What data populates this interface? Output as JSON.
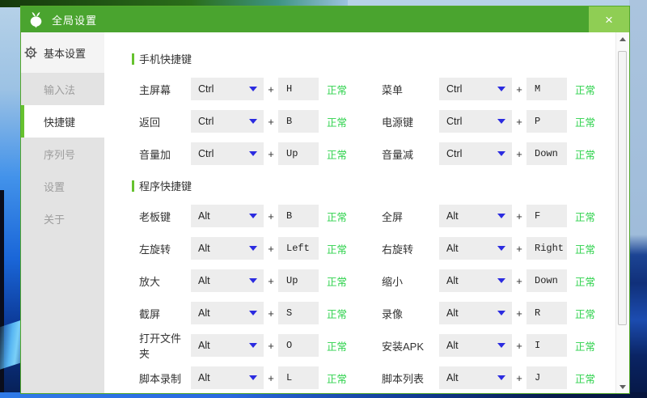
{
  "window": {
    "title": "全局设置",
    "close_glyph": "×"
  },
  "sidebar": {
    "primary": {
      "label": "基本设置",
      "icon": "gear-icon"
    },
    "items": [
      {
        "label": "输入法",
        "selected": false
      },
      {
        "label": "快捷键",
        "selected": true
      },
      {
        "label": "序列号",
        "selected": false
      },
      {
        "label": "设置",
        "selected": false
      },
      {
        "label": "关于",
        "selected": false
      }
    ]
  },
  "content": {
    "plus_sign": "+",
    "sections": [
      {
        "title": "手机快捷键",
        "pairs": [
          [
            {
              "label": "主屏幕",
              "modifier": "Ctrl",
              "key": "H",
              "status": "正常"
            },
            {
              "label": "菜单",
              "modifier": "Ctrl",
              "key": "M",
              "status": "正常"
            }
          ],
          [
            {
              "label": "返回",
              "modifier": "Ctrl",
              "key": "B",
              "status": "正常"
            },
            {
              "label": "电源键",
              "modifier": "Ctrl",
              "key": "P",
              "status": "正常"
            }
          ],
          [
            {
              "label": "音量加",
              "modifier": "Ctrl",
              "key": "Up",
              "status": "正常"
            },
            {
              "label": "音量减",
              "modifier": "Ctrl",
              "key": "Down",
              "status": "正常"
            }
          ]
        ]
      },
      {
        "title": "程序快捷键",
        "pairs": [
          [
            {
              "label": "老板键",
              "modifier": "Alt",
              "key": "B",
              "status": "正常"
            },
            {
              "label": "全屏",
              "modifier": "Alt",
              "key": "F",
              "status": "正常"
            }
          ],
          [
            {
              "label": "左旋转",
              "modifier": "Alt",
              "key": "Left",
              "status": "正常"
            },
            {
              "label": "右旋转",
              "modifier": "Alt",
              "key": "Right",
              "status": "正常"
            }
          ],
          [
            {
              "label": "放大",
              "modifier": "Alt",
              "key": "Up",
              "status": "正常"
            },
            {
              "label": "缩小",
              "modifier": "Alt",
              "key": "Down",
              "status": "正常"
            }
          ],
          [
            {
              "label": "截屏",
              "modifier": "Alt",
              "key": "S",
              "status": "正常"
            },
            {
              "label": "录像",
              "modifier": "Alt",
              "key": "R",
              "status": "正常"
            }
          ],
          [
            {
              "label": "打开文件夹",
              "modifier": "Alt",
              "key": "O",
              "status": "正常"
            },
            {
              "label": "安装APK",
              "modifier": "Alt",
              "key": "I",
              "status": "正常"
            }
          ],
          [
            {
              "label": "脚本录制",
              "modifier": "Alt",
              "key": "L",
              "status": "正常"
            },
            {
              "label": "脚本列表",
              "modifier": "Alt",
              "key": "J",
              "status": "正常"
            }
          ]
        ]
      }
    ]
  },
  "colors": {
    "titlebar_green": "#4aa42f",
    "close_button_green": "#8fce54",
    "accent_green": "#66c22f",
    "status_green": "#2ed24c",
    "dropdown_caret_blue": "#2b2be0"
  }
}
